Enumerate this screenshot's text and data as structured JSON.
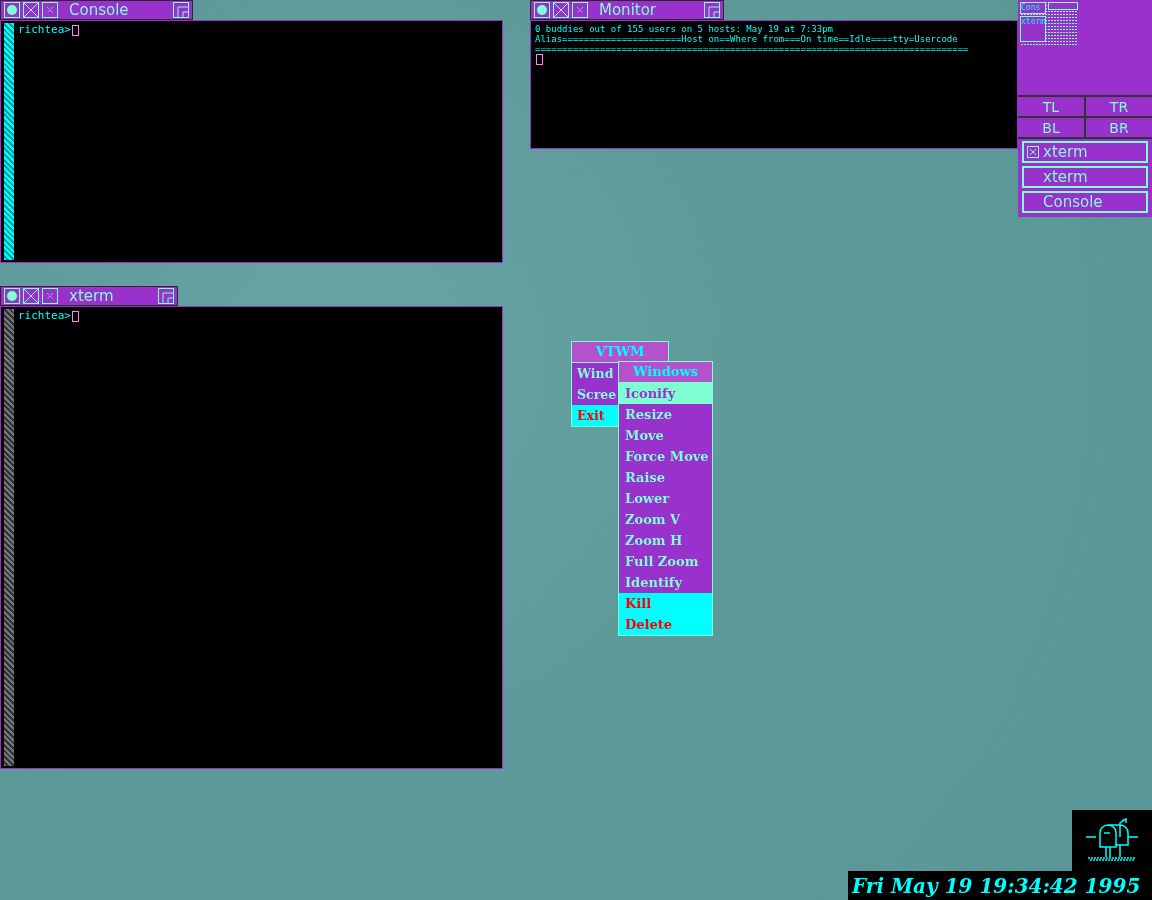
{
  "windows": [
    {
      "title": "Console",
      "active": true,
      "lines": [
        "richtea>"
      ]
    },
    {
      "title": "Monitor",
      "lines": [
        "0 buddies out of 155 users on 5 hosts: May 19 at 7:33pm",
        "Alias======================Host on==Where from===On time==Idle====tty=Usercode",
        "================================================================================"
      ]
    },
    {
      "title": "xterm",
      "active": false,
      "lines": [
        "richtea>"
      ]
    }
  ],
  "panner": {
    "windows": [
      {
        "label": "Cons"
      },
      {
        "label": "xterm"
      }
    ],
    "buttons": [
      "TL",
      "TR",
      "BL",
      "BR"
    ]
  },
  "icon_manager": [
    {
      "label": "xterm",
      "iconified": true
    },
    {
      "label": "xterm",
      "iconified": false
    },
    {
      "label": "Console",
      "iconified": false
    }
  ],
  "root_menu": {
    "title": "VTWM",
    "items": [
      {
        "label": "Wind",
        "kind": "normal"
      },
      {
        "label": "Scree",
        "kind": "normal"
      },
      {
        "label": "Exit",
        "kind": "danger"
      }
    ]
  },
  "windows_menu": {
    "title": "Windows",
    "items": [
      {
        "label": "Iconify",
        "kind": "normal",
        "selected": true
      },
      {
        "label": "Resize",
        "kind": "normal",
        "selected": false
      },
      {
        "label": "Move",
        "kind": "normal",
        "selected": false
      },
      {
        "label": "Force Move",
        "kind": "normal",
        "selected": false
      },
      {
        "label": "Raise",
        "kind": "normal",
        "selected": false
      },
      {
        "label": "Lower",
        "kind": "normal",
        "selected": false
      },
      {
        "label": "Zoom V",
        "kind": "normal",
        "selected": false
      },
      {
        "label": "Zoom H",
        "kind": "normal",
        "selected": false
      },
      {
        "label": "Full Zoom",
        "kind": "normal",
        "selected": false
      },
      {
        "label": "Identify",
        "kind": "normal",
        "selected": false
      },
      {
        "label": "Kill",
        "kind": "danger",
        "selected": false
      },
      {
        "label": "Delete",
        "kind": "danger",
        "selected": false
      }
    ]
  },
  "clock": "Fri May 19 19:34:42 1995"
}
